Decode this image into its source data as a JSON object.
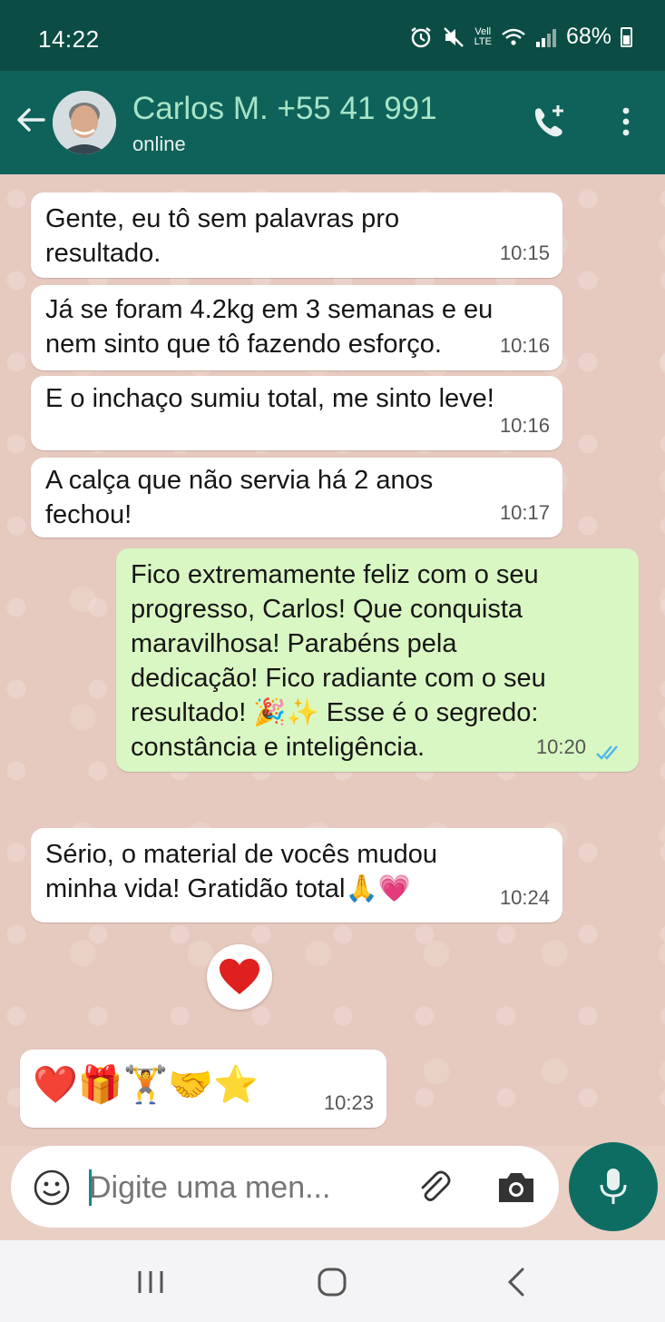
{
  "status_bar": {
    "time": "14:22",
    "carrier_top": "Vell",
    "carrier_bottom": "LTE",
    "battery": "68%"
  },
  "header": {
    "contact_name": "Carlos M. +55 41 991",
    "contact_status": "online",
    "icons": [
      "back-arrow-icon",
      "add-call-icon",
      "more-options-icon"
    ],
    "accent_color": "#0f6259"
  },
  "messages": [
    {
      "direction": "incoming",
      "text": "Gente, eu tô sem palavras pro\nresultado.",
      "time": "10:15"
    },
    {
      "direction": "incoming",
      "text": "Já se foram 4.2kg em 3 semanas e eu\nnem sinto que tô fazendo esforço.",
      "time": "10:16"
    },
    {
      "direction": "incoming",
      "text": "E o inchaço sumiu total, me sinto leve!",
      "time": "10:16"
    },
    {
      "direction": "incoming",
      "text": "A calça que não servia há 2 anos\nfechou!",
      "time": "10:17"
    },
    {
      "direction": "outgoing",
      "text": "Fico extremamente feliz com o seu\nprogresso, Carlos! Que conquista\nmaravilhosa! Parabéns pela\ndedicação! Fico radiante com o seu\nresultado! 🎉✨ Esse é o segredo:\n   constância e inteligência.",
      "time": "10:20",
      "status": "read"
    },
    {
      "direction": "incoming",
      "text": "Sério, o material de vocês mudou\nminha vida! Gratidão total🙏💗",
      "time": "10:24"
    },
    {
      "direction": "incoming",
      "text": "❤️🎁🏋️🤝⭐",
      "time": "10:23"
    }
  ],
  "reaction": "❤️",
  "input": {
    "placeholder": "Digite uma men..."
  },
  "nav_bar": {
    "icons": [
      "recent-apps-icon",
      "home-icon",
      "back-icon"
    ]
  }
}
